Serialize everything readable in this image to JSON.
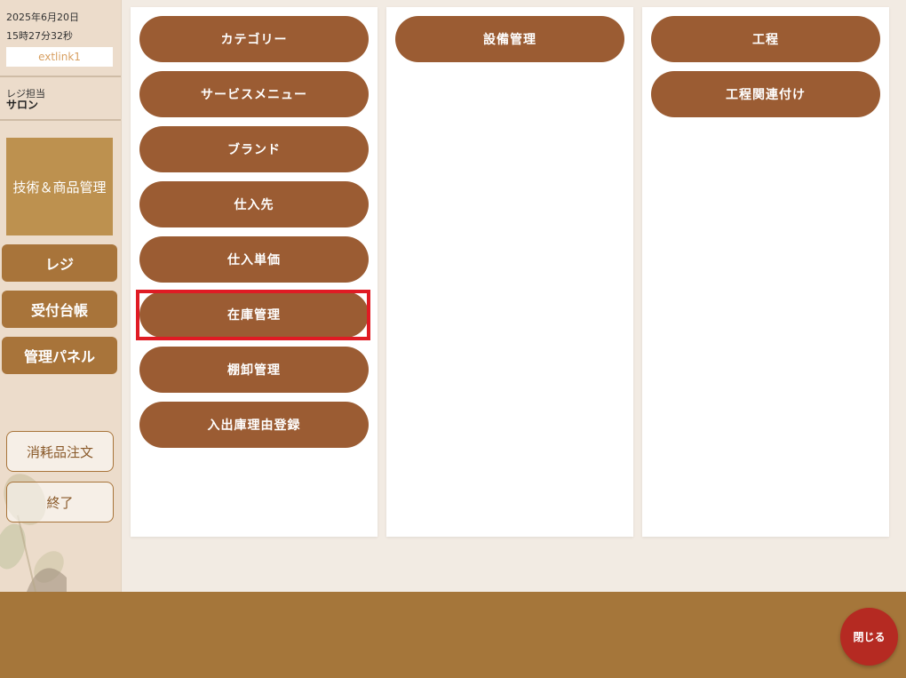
{
  "sidebar": {
    "date": "2025年6月20日",
    "time": "15時27分32秒",
    "ext_link": "extlink1",
    "staff_label": "レジ担当",
    "staff_name": "サロン",
    "current_section": "技術＆商品管理",
    "nav": [
      {
        "label": "レジ"
      },
      {
        "label": "受付台帳"
      },
      {
        "label": "管理パネル"
      }
    ],
    "actions": [
      {
        "label": "消耗品注文"
      },
      {
        "label": "終了"
      }
    ]
  },
  "panels": [
    {
      "items": [
        {
          "label": "カテゴリー"
        },
        {
          "label": "サービスメニュー"
        },
        {
          "label": "ブランド"
        },
        {
          "label": "仕入先"
        },
        {
          "label": "仕入単価"
        },
        {
          "label": "在庫管理",
          "highlighted": true
        },
        {
          "label": "棚卸管理"
        },
        {
          "label": "入出庫理由登録"
        }
      ]
    },
    {
      "items": [
        {
          "label": "設備管理"
        }
      ]
    },
    {
      "items": [
        {
          "label": "工程"
        },
        {
          "label": "工程関連付け"
        }
      ]
    }
  ],
  "footer": {
    "close_label": "閉じる"
  },
  "colors": {
    "menu_button": "#9b5c33",
    "sidebar_button": "#a8743a",
    "section_block": "#bd914f",
    "footer": "#a5763a",
    "close_button": "#b52a22",
    "highlight_border": "#e01b24"
  }
}
